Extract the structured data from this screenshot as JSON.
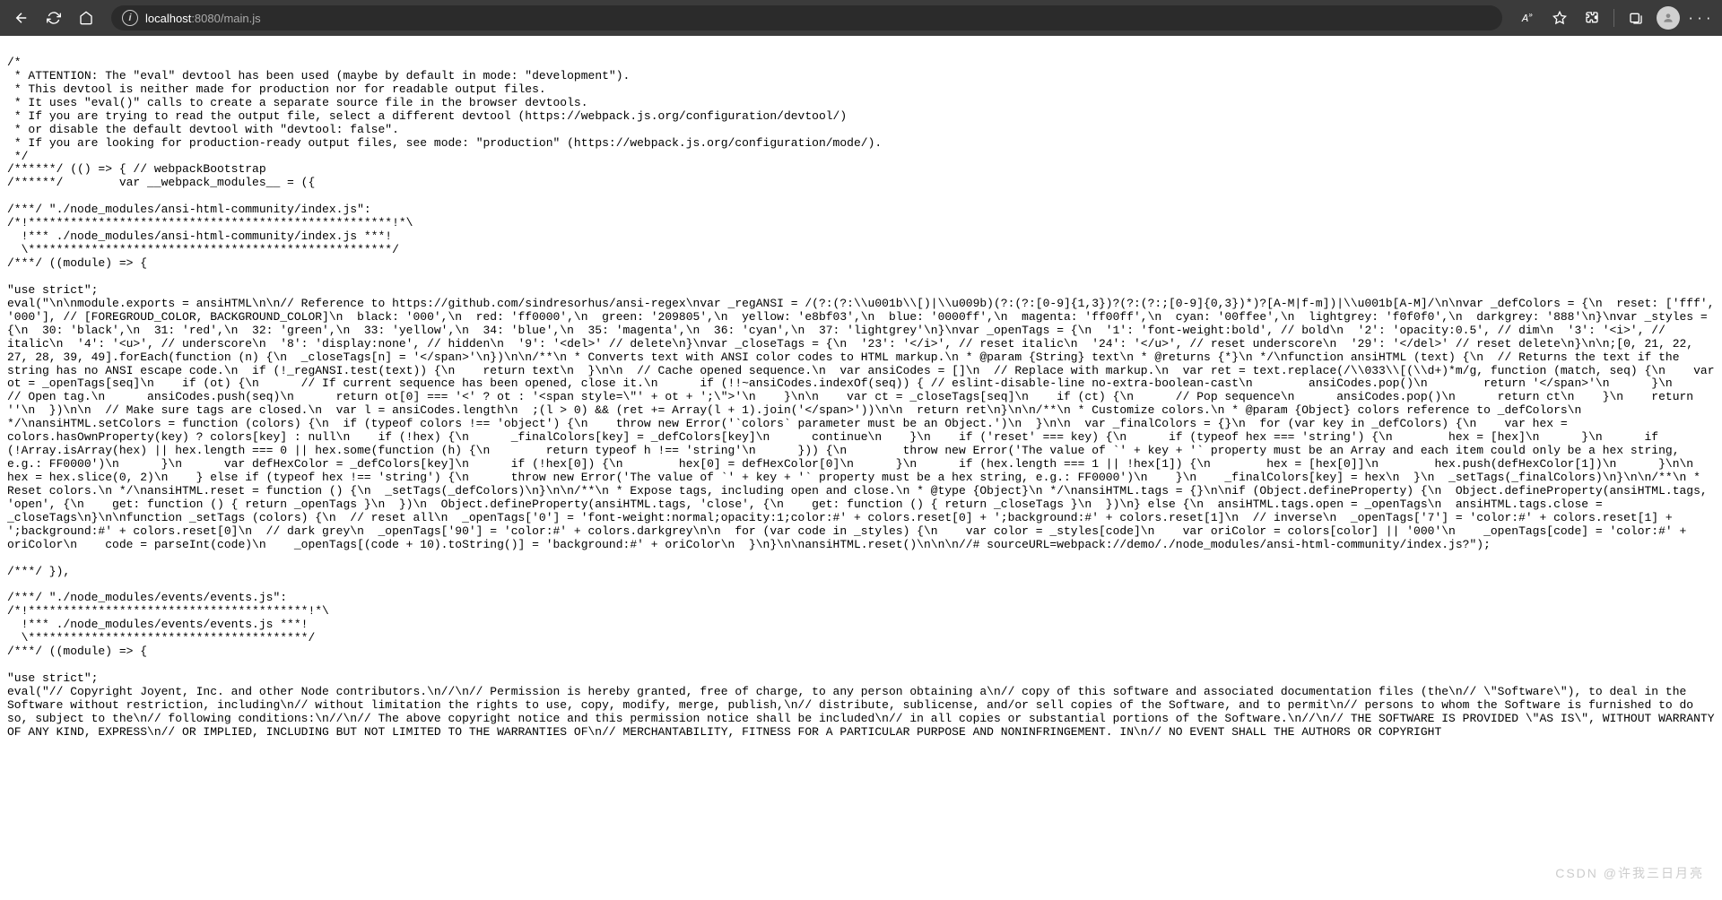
{
  "toolbar": {
    "url": {
      "host": "localhost",
      "port": ":8080",
      "path": "/main.js"
    }
  },
  "code": {
    "header": "/*\n * ATTENTION: The \"eval\" devtool has been used (maybe by default in mode: \"development\").\n * This devtool is neither made for production nor for readable output files.\n * It uses \"eval()\" calls to create a separate source file in the browser devtools.\n * If you are trying to read the output file, select a different devtool (https://webpack.js.org/configuration/devtool/)\n * or disable the default devtool with \"devtool: false\".\n * If you are looking for production-ready output files, see mode: \"production\" (https://webpack.js.org/configuration/mode/).\n */\n/******/ (() => { // webpackBootstrap\n/******/        var __webpack_modules__ = ({\n\n/***/ \"./node_modules/ansi-html-community/index.js\":\n/*!****************************************************!*\\\n  !*** ./node_modules/ansi-html-community/index.js ***!\n  \\****************************************************/\n/***/ ((module) => {\n\n\"use strict\";",
    "eval1": "eval(\"\\n\\nmodule.exports = ansiHTML\\n\\n// Reference to https://github.com/sindresorhus/ansi-regex\\nvar _regANSI = /(?:(?:\\\\u001b\\\\[)|\\\\u009b)(?:(?:[0-9]{1,3})?(?:(?:;[0-9]{0,3})*)?[A-M|f-m])|\\\\u001b[A-M]/\\n\\nvar _defColors = {\\n  reset: ['fff', '000'], // [FOREGROUD_COLOR, BACKGROUND_COLOR]\\n  black: '000',\\n  red: 'ff0000',\\n  green: '209805',\\n  yellow: 'e8bf03',\\n  blue: '0000ff',\\n  magenta: 'ff00ff',\\n  cyan: '00ffee',\\n  lightgrey: 'f0f0f0',\\n  darkgrey: '888'\\n}\\nvar _styles = {\\n  30: 'black',\\n  31: 'red',\\n  32: 'green',\\n  33: 'yellow',\\n  34: 'blue',\\n  35: 'magenta',\\n  36: 'cyan',\\n  37: 'lightgrey'\\n}\\nvar _openTags = {\\n  '1': 'font-weight:bold', // bold\\n  '2': 'opacity:0.5', // dim\\n  '3': '<i>', // italic\\n  '4': '<u>', // underscore\\n  '8': 'display:none', // hidden\\n  '9': '<del>' // delete\\n}\\nvar _closeTags = {\\n  '23': '</i>', // reset italic\\n  '24': '</u>', // reset underscore\\n  '29': '</del>' // reset delete\\n}\\n\\n;[0, 21, 22, 27, 28, 39, 49].forEach(function (n) {\\n  _closeTags[n] = '</span>'\\n})\\n\\n/**\\n * Converts text with ANSI color codes to HTML markup.\\n * @param {String} text\\n * @returns {*}\\n */\\nfunction ansiHTML (text) {\\n  // Returns the text if the string has no ANSI escape code.\\n  if (!_regANSI.test(text)) {\\n    return text\\n  }\\n\\n  // Cache opened sequence.\\n  var ansiCodes = []\\n  // Replace with markup.\\n  var ret = text.replace(/\\\\033\\\\[(\\\\d+)*m/g, function (match, seq) {\\n    var ot = _openTags[seq]\\n    if (ot) {\\n      // If current sequence has been opened, close it.\\n      if (!!~ansiCodes.indexOf(seq)) { // eslint-disable-line no-extra-boolean-cast\\n        ansiCodes.pop()\\n        return '</span>'\\n      }\\n      // Open tag.\\n      ansiCodes.push(seq)\\n      return ot[0] === '<' ? ot : '<span style=\\\"' + ot + ';\\\">'\\n    }\\n\\n    var ct = _closeTags[seq]\\n    if (ct) {\\n      // Pop sequence\\n      ansiCodes.pop()\\n      return ct\\n    }\\n    return ''\\n  })\\n\\n  // Make sure tags are closed.\\n  var l = ansiCodes.length\\n  ;(l > 0) && (ret += Array(l + 1).join('</span>'))\\n\\n  return ret\\n}\\n\\n/**\\n * Customize colors.\\n * @param {Object} colors reference to _defColors\\n */\\nansiHTML.setColors = function (colors) {\\n  if (typeof colors !== 'object') {\\n    throw new Error('`colors` parameter must be an Object.')\\n  }\\n\\n  var _finalColors = {}\\n  for (var key in _defColors) {\\n    var hex = colors.hasOwnProperty(key) ? colors[key] : null\\n    if (!hex) {\\n      _finalColors[key] = _defColors[key]\\n      continue\\n    }\\n    if ('reset' === key) {\\n      if (typeof hex === 'string') {\\n        hex = [hex]\\n      }\\n      if (!Array.isArray(hex) || hex.length === 0 || hex.some(function (h) {\\n        return typeof h !== 'string'\\n      })) {\\n        throw new Error('The value of `' + key + '` property must be an Array and each item could only be a hex string, e.g.: FF0000')\\n      }\\n      var defHexColor = _defColors[key]\\n      if (!hex[0]) {\\n        hex[0] = defHexColor[0]\\n      }\\n      if (hex.length === 1 || !hex[1]) {\\n        hex = [hex[0]]\\n        hex.push(defHexColor[1])\\n      }\\n\\n      hex = hex.slice(0, 2)\\n    } else if (typeof hex !== 'string') {\\n      throw new Error('The value of `' + key + '` property must be a hex string, e.g.: FF0000')\\n    }\\n    _finalColors[key] = hex\\n  }\\n  _setTags(_finalColors)\\n}\\n\\n/**\\n * Reset colors.\\n */\\nansiHTML.reset = function () {\\n  _setTags(_defColors)\\n}\\n\\n/**\\n * Expose tags, including open and close.\\n * @type {Object}\\n */\\nansiHTML.tags = {}\\n\\nif (Object.defineProperty) {\\n  Object.defineProperty(ansiHTML.tags, 'open', {\\n    get: function () { return _openTags }\\n  })\\n  Object.defineProperty(ansiHTML.tags, 'close', {\\n    get: function () { return _closeTags }\\n  })\\n} else {\\n  ansiHTML.tags.open = _openTags\\n  ansiHTML.tags.close = _closeTags\\n}\\n\\nfunction _setTags (colors) {\\n  // reset all\\n  _openTags['0'] = 'font-weight:normal;opacity:1;color:#' + colors.reset[0] + ';background:#' + colors.reset[1]\\n  // inverse\\n  _openTags['7'] = 'color:#' + colors.reset[1] + ';background:#' + colors.reset[0]\\n  // dark grey\\n  _openTags['90'] = 'color:#' + colors.darkgrey\\n\\n  for (var code in _styles) {\\n    var color = _styles[code]\\n    var oriColor = colors[color] || '000'\\n    _openTags[code] = 'color:#' + oriColor\\n    code = parseInt(code)\\n    _openTags[(code + 10).toString()] = 'background:#' + oriColor\\n  }\\n}\\n\\nansiHTML.reset()\\n\\n\\n//# sourceURL=webpack://demo/./node_modules/ansi-html-community/index.js?\");\n\n/***/ }),\n\n/***/ \"./node_modules/events/events.js\":\n/*!****************************************!*\\\n  !*** ./node_modules/events/events.js ***!\n  \\****************************************/\n/***/ ((module) => {\n\n\"use strict\";",
    "eval2": "eval(\"// Copyright Joyent, Inc. and other Node contributors.\\n//\\n// Permission is hereby granted, free of charge, to any person obtaining a\\n// copy of this software and associated documentation files (the\\n// \\\"Software\\\"), to deal in the Software without restriction, including\\n// without limitation the rights to use, copy, modify, merge, publish,\\n// distribute, sublicense, and/or sell copies of the Software, and to permit\\n// persons to whom the Software is furnished to do so, subject to the\\n// following conditions:\\n//\\n// The above copyright notice and this permission notice shall be included\\n// in all copies or substantial portions of the Software.\\n//\\n// THE SOFTWARE IS PROVIDED \\\"AS IS\\\", WITHOUT WARRANTY OF ANY KIND, EXPRESS\\n// OR IMPLIED, INCLUDING BUT NOT LIMITED TO THE WARRANTIES OF\\n// MERCHANTABILITY, FITNESS FOR A PARTICULAR PURPOSE AND NONINFRINGEMENT. IN\\n// NO EVENT SHALL THE AUTHORS OR COPYRIGHT"
  },
  "watermark": "CSDN @许我三日月亮"
}
